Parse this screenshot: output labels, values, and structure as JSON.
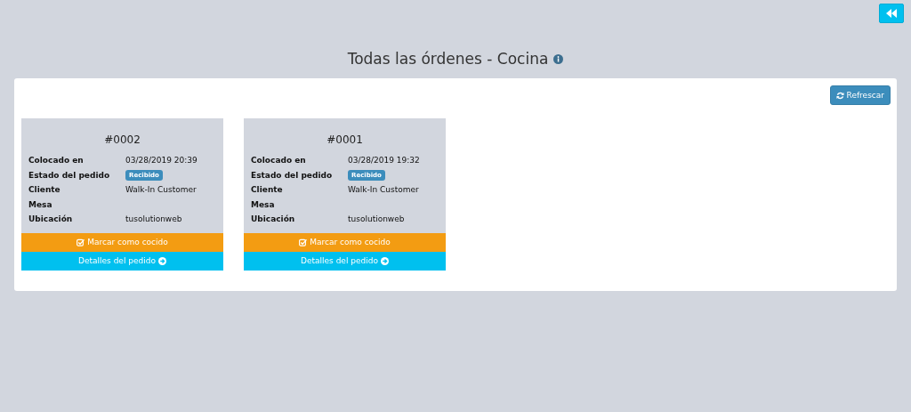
{
  "title": "Todas las órdenes - Cocina",
  "refresh_button": "Refrescar",
  "orders": [
    {
      "number": "#0002",
      "fields": [
        {
          "label": "Colocado en",
          "kind": "text",
          "value": "03/28/2019 20:39"
        },
        {
          "label": "Estado del pedido",
          "kind": "badge",
          "value": "Recibido"
        },
        {
          "label": "Cliente",
          "kind": "text",
          "value": "Walk-In Customer"
        },
        {
          "label": "Mesa",
          "kind": "text"
        },
        {
          "label": "Ubicación",
          "kind": "text",
          "value": "tusolutionweb"
        }
      ],
      "mark_button": "Marcar como cocido",
      "details_link": "Detalles del pedido"
    },
    {
      "number": "#0001",
      "fields": [
        {
          "label": "Colocado en",
          "kind": "text",
          "value": "03/28/2019 19:32"
        },
        {
          "label": "Estado del pedido",
          "kind": "badge",
          "value": "Recibido"
        },
        {
          "label": "Cliente",
          "kind": "text",
          "value": "Walk-In Customer"
        },
        {
          "label": "Mesa",
          "kind": "text"
        },
        {
          "label": "Ubicación",
          "kind": "text",
          "value": "tusolutionweb"
        }
      ],
      "mark_button": "Marcar como cocido",
      "details_link": "Detalles del pedido"
    }
  ]
}
